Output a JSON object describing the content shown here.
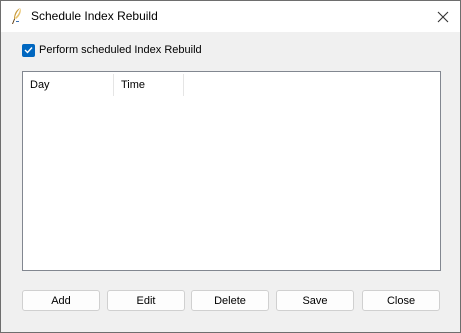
{
  "window": {
    "title": "Schedule Index Rebuild",
    "icon": "quill-icon"
  },
  "options": {
    "perform_rebuild_label": "Perform scheduled Index Rebuild",
    "perform_rebuild_checked": true
  },
  "schedule_list": {
    "columns": [
      "Day",
      "Time"
    ],
    "rows": []
  },
  "buttons": {
    "add": "Add",
    "edit": "Edit",
    "delete": "Delete",
    "save": "Save",
    "close": "Close"
  },
  "colors": {
    "accent": "#0067c0",
    "dialog_background": "#f0f0f0",
    "titlebar_background": "#ffffff"
  }
}
